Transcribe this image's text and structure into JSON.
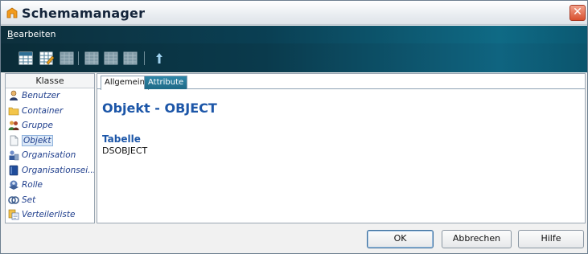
{
  "window": {
    "title": "Schemamanager",
    "close_glyph": "✕"
  },
  "menubar": {
    "items": [
      {
        "accel": "B",
        "rest": "earbeiten"
      }
    ]
  },
  "toolbar": {
    "buttons": [
      {
        "icon": "grid-icon"
      },
      {
        "icon": "grid-edit-icon"
      },
      {
        "icon": "grid-delete-icon"
      },
      {
        "icon": "grid-disabled-icon"
      },
      {
        "icon": "grid-disabled-icon"
      },
      {
        "icon": "grid-disabled-icon"
      },
      {
        "icon": "arrow-up-icon"
      }
    ]
  },
  "class_list": {
    "header": "Klasse",
    "items": [
      {
        "label": "Benutzer",
        "icon": "user-icon",
        "selected": false
      },
      {
        "label": "Container",
        "icon": "folder-icon",
        "selected": false
      },
      {
        "label": "Gruppe",
        "icon": "group-icon",
        "selected": false
      },
      {
        "label": "Objekt",
        "icon": "document-icon",
        "selected": true
      },
      {
        "label": "Organisation",
        "icon": "organization-icon",
        "selected": false
      },
      {
        "label": "Organisationsei...",
        "icon": "book-icon",
        "selected": false
      },
      {
        "label": "Rolle",
        "icon": "role-icon",
        "selected": false
      },
      {
        "label": "Set",
        "icon": "set-icon",
        "selected": false
      },
      {
        "label": "Verteilerliste",
        "icon": "distribution-list-icon",
        "selected": false
      }
    ]
  },
  "detail": {
    "tabs": [
      {
        "label": "Allgemein",
        "active": true
      },
      {
        "label": "Attribute",
        "active": false
      }
    ],
    "title": "Objekt - OBJECT",
    "section_heading": "Tabelle",
    "section_value": "DSOBJECT"
  },
  "buttons": {
    "ok": "OK",
    "cancel": "Abbrechen",
    "help": "Hilfe"
  },
  "colors": {
    "accent_title": "#1c56a8",
    "toolbar_dark": "#0a2c38",
    "toolbar_light": "#0f6480",
    "close_red": "#d9502f"
  }
}
